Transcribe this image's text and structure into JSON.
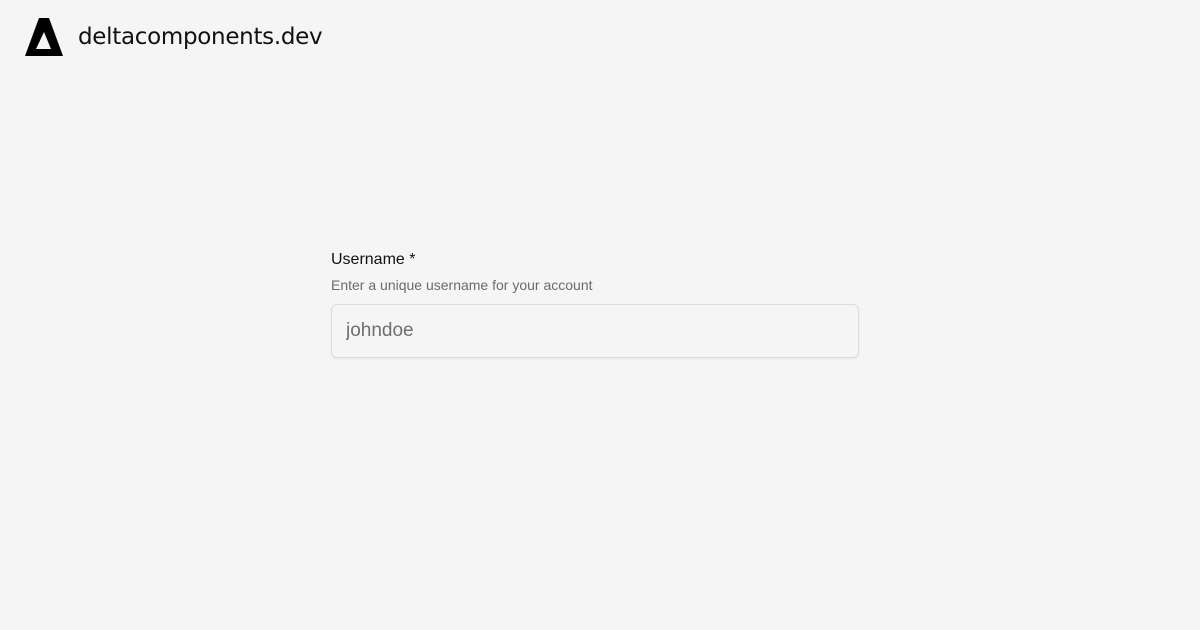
{
  "header": {
    "brand_name": "deltacomponents.dev",
    "logo_icon": "delta-triangle-icon"
  },
  "form": {
    "username": {
      "label": "Username *",
      "description": "Enter a unique username for your account",
      "placeholder": "johndoe",
      "value": ""
    }
  }
}
